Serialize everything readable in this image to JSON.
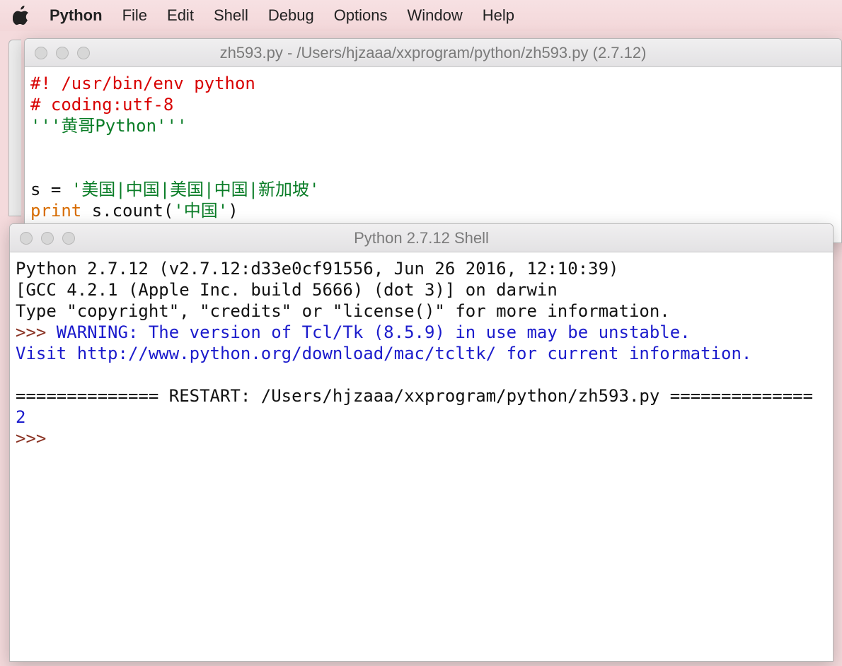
{
  "menubar": {
    "app": "Python",
    "items": [
      "File",
      "Edit",
      "Shell",
      "Debug",
      "Options",
      "Window",
      "Help"
    ]
  },
  "editorWindow": {
    "title": "zh593.py - /Users/hjzaaa/xxprogram/python/zh593.py (2.7.12)",
    "code": {
      "shebang": "#! /usr/bin/env python",
      "coding": "# coding:utf-8",
      "docstring": "'''黄哥Python'''",
      "assign_lhs": "s = ",
      "assign_rhs": "'美国|中国|美国|中国|新加坡'",
      "print_kw": "print",
      "print_mid": " s.count(",
      "print_arg": "'中国'",
      "print_end": ")"
    }
  },
  "shellWindow": {
    "title": "Python 2.7.12 Shell",
    "banner1": "Python 2.7.12 (v2.7.12:d33e0cf91556, Jun 26 2016, 12:10:39) ",
    "banner2": "[GCC 4.2.1 (Apple Inc. build 5666) (dot 3)] on darwin",
    "banner3": "Type \"copyright\", \"credits\" or \"license()\" for more information.",
    "prompt": ">>> ",
    "warning1": "WARNING: The version of Tcl/Tk (8.5.9) in use may be unstable.",
    "warning2": "Visit http://www.python.org/download/mac/tcltk/ for current information.",
    "restart": "============== RESTART: /Users/hjzaaa/xxprogram/python/zh593.py ==============",
    "output": "2",
    "prompt2": ">>> "
  }
}
